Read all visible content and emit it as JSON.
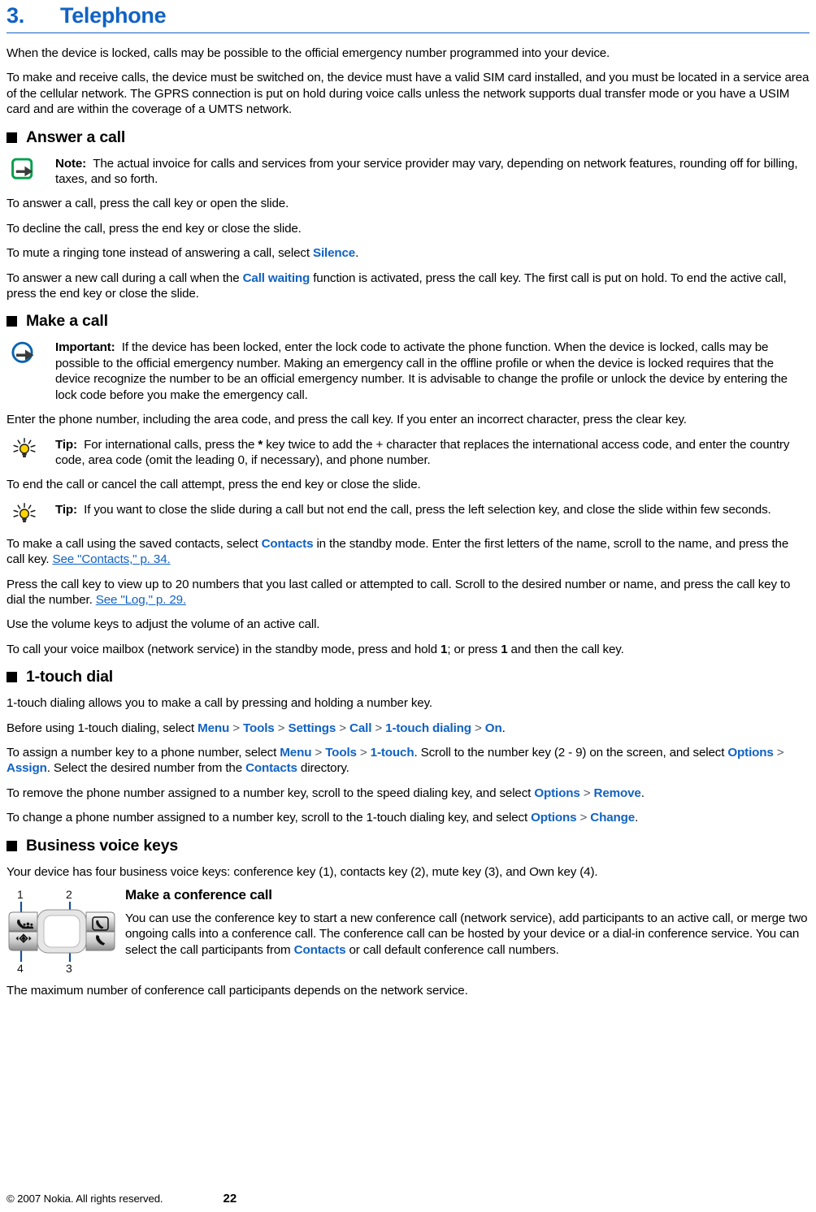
{
  "chapter": {
    "number": "3.",
    "title": "Telephone"
  },
  "intro": {
    "p1": "When the device is locked, calls may be possible to the official emergency number programmed into your device.",
    "p2": "To make and receive calls, the device must be switched on, the device must have a valid SIM card installed, and you must be located in a service area of the cellular network. The GPRS connection is put on hold during voice calls unless the network supports dual transfer mode or you have a USIM card and are within the coverage of a UMTS network."
  },
  "answer_section": {
    "heading": "Answer a call",
    "note": {
      "label": "Note:",
      "icon": "note-arrow-icon",
      "text": "The actual invoice for calls and services from your service provider may vary, depending on network features, rounding off for billing, taxes, and so forth."
    },
    "p1": "To answer a call, press the call key or open the slide.",
    "p2": "To decline the call, press the end key or close the slide.",
    "p3_pre": "To mute a ringing tone instead of answering a call, select ",
    "p3_ui": "Silence",
    "p3_post": ".",
    "p4_pre": "To answer a new call during a call when the ",
    "p4_ui": "Call waiting",
    "p4_post": " function is activated, press the call key. The first call is put on hold. To end the active call, press the end key or close the slide."
  },
  "make_section": {
    "heading": "Make a call",
    "important": {
      "label": "Important:",
      "icon": "important-arrow-icon",
      "text": "If the device has been locked, enter the lock code to activate the phone function. When the device is locked, calls may be possible to the official emergency number. Making an emergency call in the offline profile or when the device is locked requires that the device recognize the number to be an official emergency number. It is advisable to change the profile or unlock the device by entering the lock code before you make the emergency call."
    },
    "p1": "Enter the phone number, including the area code, and press the call key. If you enter an incorrect character, press the clear key.",
    "tip1": {
      "label": "Tip:",
      "icon": "tip-lightbulb-icon",
      "text_pre": "For international calls, press the ",
      "text_key": "*",
      "text_post": " key twice to add the + character that replaces the international access code, and enter the country code, area code (omit the leading 0, if necessary), and phone number."
    },
    "p2": "To end the call or cancel the call attempt, press the end key or close the slide.",
    "tip2": {
      "label": "Tip:",
      "icon": "tip-lightbulb-icon",
      "text": "If you want to close the slide during a call but not end the call, press the left selection key, and close the slide within few seconds."
    },
    "p3_pre": "To make a call using the saved contacts, select ",
    "p3_ui": "Contacts",
    "p3_mid": " in the standby mode. Enter the first letters of the name, scroll to the name, and press the call key. ",
    "p3_link": "See \"Contacts,\" p. 34.",
    "p4_pre": "Press the call key to view up to 20 numbers that you last called or attempted to call. Scroll to the desired number or name, and press the call key to dial the number. ",
    "p4_link": "See \"Log,\" p. 29.",
    "p5": "Use the volume keys to adjust the volume of an active call.",
    "p6_pre": "To call your voice mailbox (network service) in the standby mode, press and hold ",
    "p6_key1": "1",
    "p6_mid": "; or press ",
    "p6_key2": "1",
    "p6_post": " and then the call key."
  },
  "onetouch_section": {
    "heading": "1-touch dial",
    "p1": "1-touch dialing allows you to make a call by pressing and holding a number key.",
    "p2_pre": "Before using 1-touch dialing, select ",
    "p2_path": [
      "Menu",
      "Tools",
      "Settings",
      "Call",
      "1-touch dialing",
      "On"
    ],
    "p2_post": ".",
    "p3_pre": "To assign a number key to a phone number, select ",
    "p3_path": [
      "Menu",
      "Tools",
      "1-touch"
    ],
    "p3_mid": ". Scroll to the number key (2 - 9) on the screen, and select ",
    "p3_path2": [
      "Options",
      "Assign"
    ],
    "p3_mid2": ". Select the desired number from the ",
    "p3_ui3": "Contacts",
    "p3_post": " directory.",
    "p4_pre": "To remove the phone number assigned to a number key, scroll to the speed dialing key, and select ",
    "p4_path": [
      "Options",
      "Remove"
    ],
    "p4_post": ".",
    "p5_pre": "To change a phone number assigned to a number key, scroll to the 1-touch dialing key, and select ",
    "p5_path": [
      "Options",
      "Change"
    ],
    "p5_post": "."
  },
  "business_section": {
    "heading": "Business voice keys",
    "p1": "Your device has four business voice keys: conference key (1), contacts key (2), mute key (3), and Own key (4).",
    "figure": {
      "callouts": [
        "1",
        "2",
        "3",
        "4"
      ],
      "keys": {
        "top_left": "conference-key-icon",
        "top_right": "contacts-key-icon",
        "bottom_left": "navigation-key-icon",
        "bottom_right": "own-key-icon"
      }
    },
    "subheading": "Make a conference call",
    "p2_pre": "You can use the conference key to start a new conference call (network service), add participants to an active call, or merge two ongoing calls into a conference call. The conference call can be hosted by your device or a dial-in conference service. You can select the call participants from ",
    "p2_ui": "Contacts",
    "p2_post": " or call default conference call numbers.",
    "p3": "The maximum number of conference call participants depends on the network service."
  },
  "footer": {
    "copyright": "© 2007 Nokia. All rights reserved.",
    "page_number": "22"
  },
  "colors": {
    "accent_blue": "#1062c4",
    "note_green": "#00a04b",
    "important_blue": "#0a62b0",
    "tip_yellow": "#ffd400",
    "text_black": "#000000"
  }
}
